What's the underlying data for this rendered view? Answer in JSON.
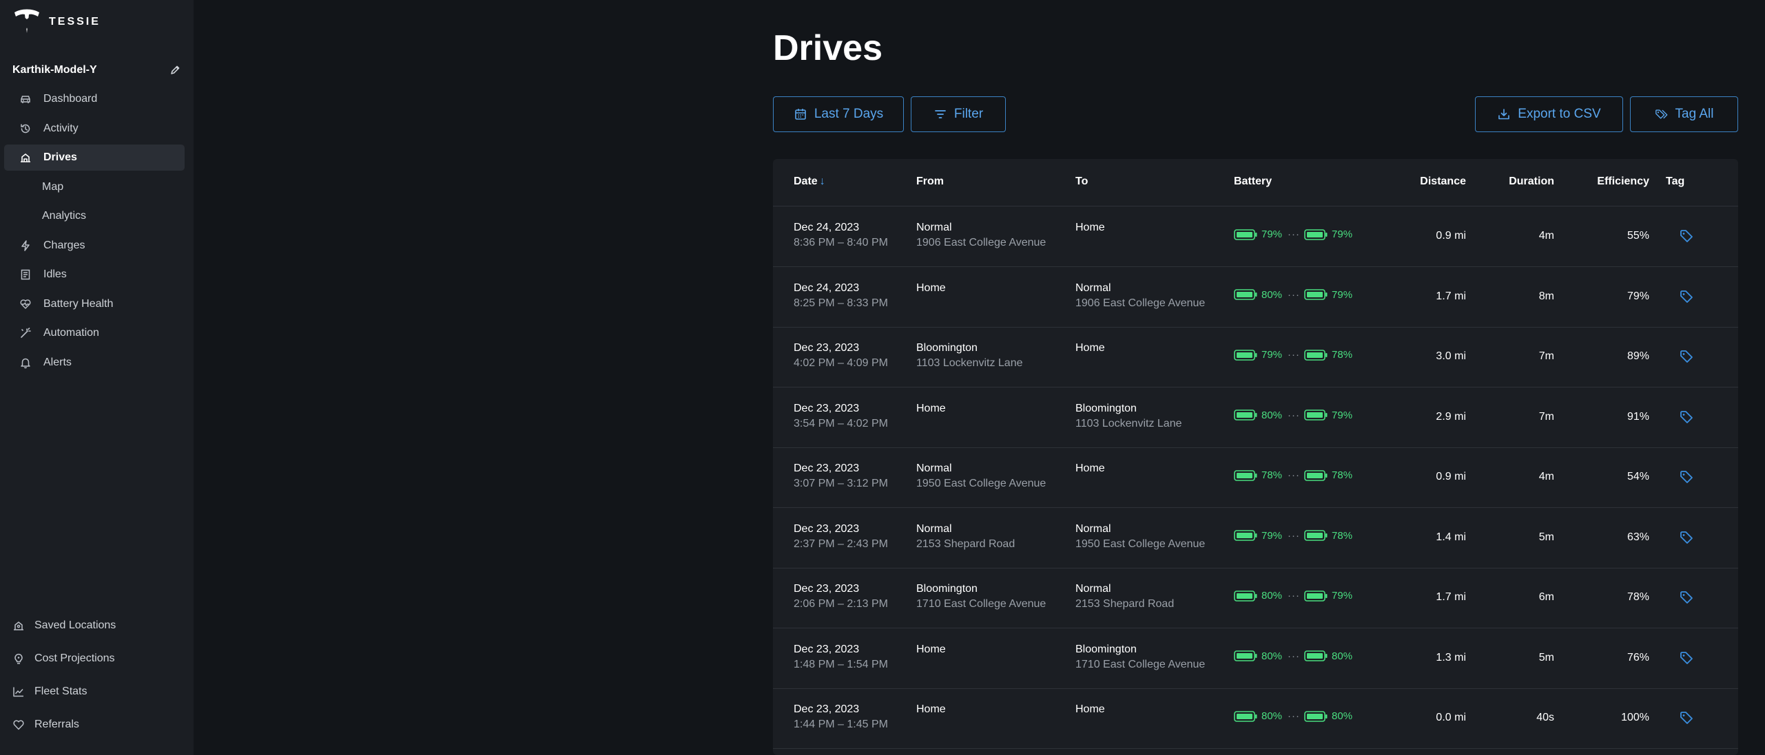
{
  "app": {
    "logo_text": "TESSIE",
    "vehicle_name": "Karthik-Model-Y"
  },
  "nav": {
    "items": [
      {
        "label": "Dashboard",
        "icon": "car-icon"
      },
      {
        "label": "Activity",
        "icon": "history-icon"
      },
      {
        "label": "Drives",
        "icon": "route-icon",
        "active": true
      },
      {
        "label": "Map",
        "sub": true
      },
      {
        "label": "Analytics",
        "sub": true
      },
      {
        "label": "Charges",
        "icon": "bolt-icon"
      },
      {
        "label": "Idles",
        "icon": "receipt-icon"
      },
      {
        "label": "Battery Health",
        "icon": "heart-pulse-icon"
      },
      {
        "label": "Automation",
        "icon": "wand-icon"
      },
      {
        "label": "Alerts",
        "icon": "bell-icon"
      }
    ],
    "bottom": [
      {
        "label": "Saved Locations",
        "icon": "map-pin-icon"
      },
      {
        "label": "Cost Projections",
        "icon": "bulb-icon"
      },
      {
        "label": "Fleet Stats",
        "icon": "chart-line-icon"
      },
      {
        "label": "Referrals",
        "icon": "heart-icon"
      }
    ]
  },
  "page": {
    "title": "Drives"
  },
  "toolbar": {
    "date_label": "Last 7 Days",
    "filter_label": "Filter",
    "export_label": "Export to CSV",
    "tag_all_label": "Tag All"
  },
  "table": {
    "headers": {
      "date": "Date",
      "from": "From",
      "to": "To",
      "battery": "Battery",
      "distance": "Distance",
      "duration": "Duration",
      "efficiency": "Efficiency",
      "tag": "Tag"
    },
    "rows": [
      {
        "date": "Dec 24, 2023",
        "time": "8:36 PM – 8:40 PM",
        "from_name": "Normal",
        "from_addr": "1906 East College Avenue",
        "to_name": "Home",
        "to_addr": "",
        "batt_start": "79%",
        "batt_end": "79%",
        "distance": "0.9 mi",
        "duration": "4m",
        "efficiency": "55%"
      },
      {
        "date": "Dec 24, 2023",
        "time": "8:25 PM – 8:33 PM",
        "from_name": "Home",
        "from_addr": "",
        "to_name": "Normal",
        "to_addr": "1906 East College Avenue",
        "batt_start": "80%",
        "batt_end": "79%",
        "distance": "1.7 mi",
        "duration": "8m",
        "efficiency": "79%"
      },
      {
        "date": "Dec 23, 2023",
        "time": "4:02 PM – 4:09 PM",
        "from_name": "Bloomington",
        "from_addr": "1103 Lockenvitz Lane",
        "to_name": "Home",
        "to_addr": "",
        "batt_start": "79%",
        "batt_end": "78%",
        "distance": "3.0 mi",
        "duration": "7m",
        "efficiency": "89%"
      },
      {
        "date": "Dec 23, 2023",
        "time": "3:54 PM – 4:02 PM",
        "from_name": "Home",
        "from_addr": "",
        "to_name": "Bloomington",
        "to_addr": "1103 Lockenvitz Lane",
        "batt_start": "80%",
        "batt_end": "79%",
        "distance": "2.9 mi",
        "duration": "7m",
        "efficiency": "91%"
      },
      {
        "date": "Dec 23, 2023",
        "time": "3:07 PM – 3:12 PM",
        "from_name": "Normal",
        "from_addr": "1950 East College Avenue",
        "to_name": "Home",
        "to_addr": "",
        "batt_start": "78%",
        "batt_end": "78%",
        "distance": "0.9 mi",
        "duration": "4m",
        "efficiency": "54%"
      },
      {
        "date": "Dec 23, 2023",
        "time": "2:37 PM – 2:43 PM",
        "from_name": "Normal",
        "from_addr": "2153 Shepard Road",
        "to_name": "Normal",
        "to_addr": "1950 East College Avenue",
        "batt_start": "79%",
        "batt_end": "78%",
        "distance": "1.4 mi",
        "duration": "5m",
        "efficiency": "63%"
      },
      {
        "date": "Dec 23, 2023",
        "time": "2:06 PM – 2:13 PM",
        "from_name": "Bloomington",
        "from_addr": "1710 East College Avenue",
        "to_name": "Normal",
        "to_addr": "2153 Shepard Road",
        "batt_start": "80%",
        "batt_end": "79%",
        "distance": "1.7 mi",
        "duration": "6m",
        "efficiency": "78%"
      },
      {
        "date": "Dec 23, 2023",
        "time": "1:48 PM – 1:54 PM",
        "from_name": "Home",
        "from_addr": "",
        "to_name": "Bloomington",
        "to_addr": "1710 East College Avenue",
        "batt_start": "80%",
        "batt_end": "80%",
        "distance": "1.3 mi",
        "duration": "5m",
        "efficiency": "76%"
      },
      {
        "date": "Dec 23, 2023",
        "time": "1:44 PM – 1:45 PM",
        "from_name": "Home",
        "from_addr": "",
        "to_name": "Home",
        "to_addr": "",
        "batt_start": "80%",
        "batt_end": "80%",
        "distance": "0.0 mi",
        "duration": "40s",
        "efficiency": "100%"
      }
    ]
  },
  "colors": {
    "accent": "#3b8fe0",
    "battery": "#4ade80",
    "background": "#121519",
    "sidebar": "#1b1e23"
  }
}
